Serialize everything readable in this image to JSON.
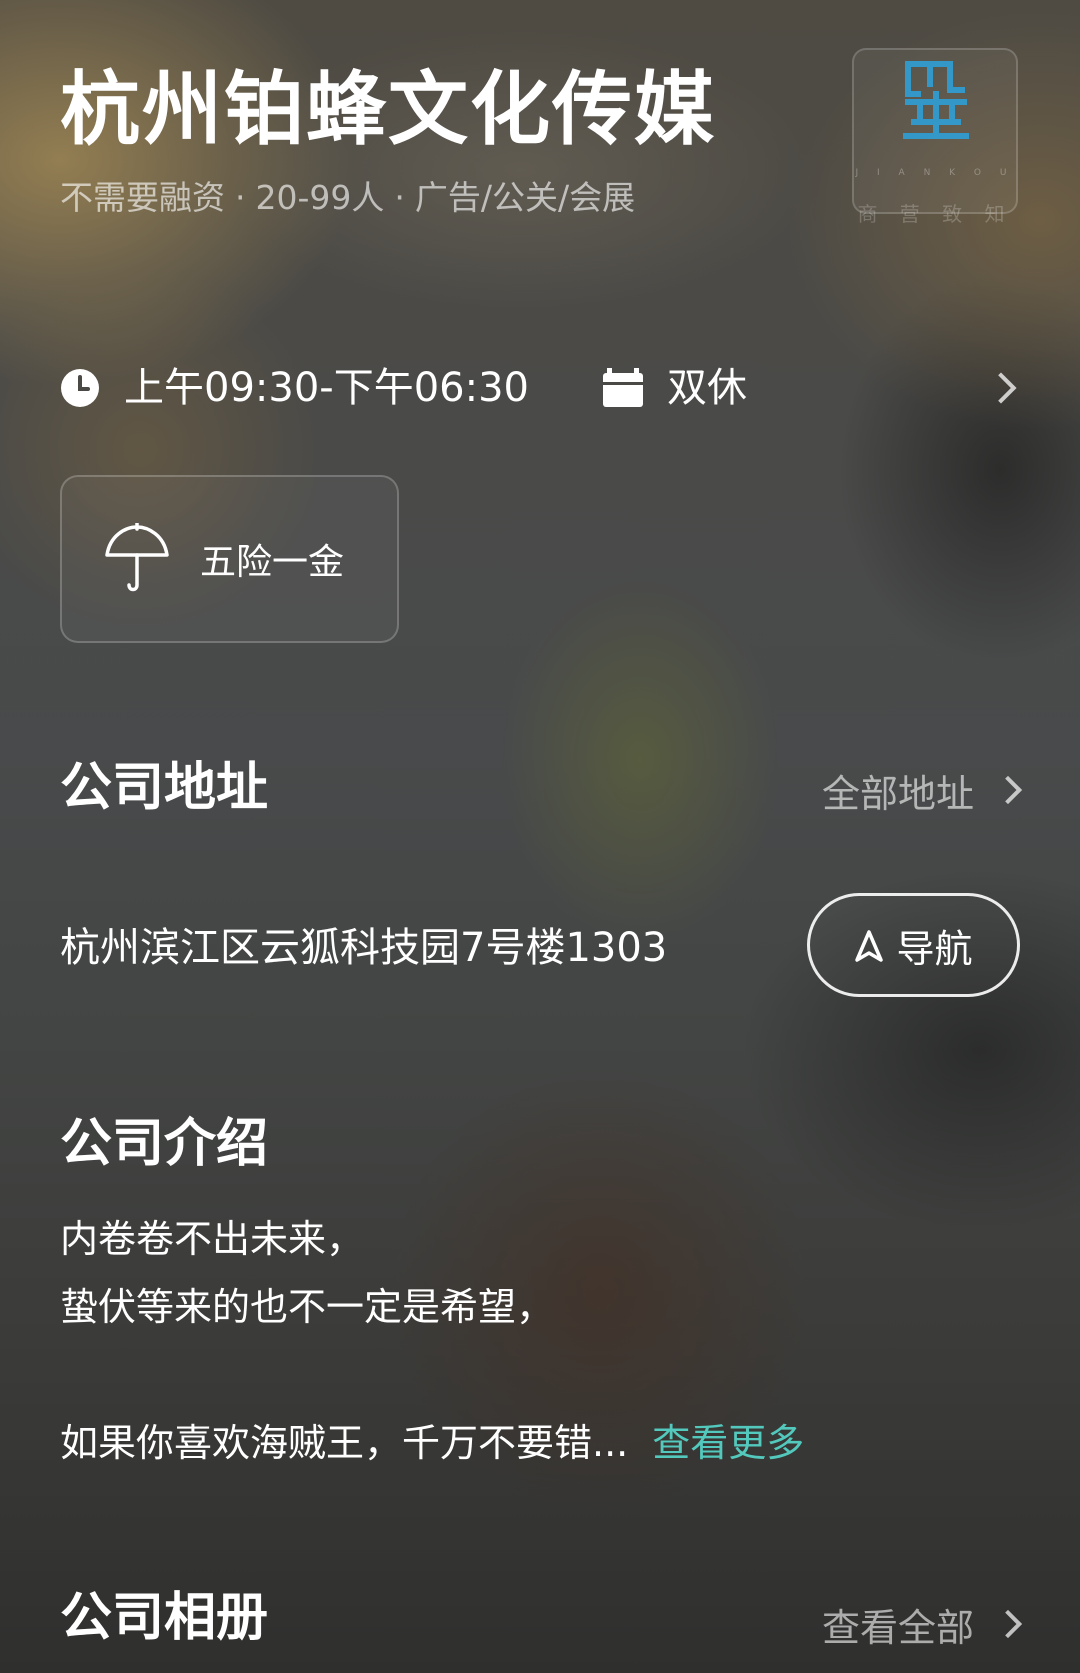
{
  "company": {
    "name": "杭州铂蜂文化传媒",
    "financing": "不需要融资",
    "size": "20-99人",
    "industry": "广告/公关/会展",
    "separator": "·",
    "logo_text": "商 营 致 知",
    "logo_tiny": "J I A N K O U"
  },
  "work": {
    "hours": "上午09:30-下午06:30",
    "rest": "双休"
  },
  "benefits": [
    {
      "label": "五险一金",
      "icon": "umbrella-icon"
    }
  ],
  "address_section": {
    "title": "公司地址",
    "all_link": "全部地址",
    "address": "杭州滨江区云狐科技园7号楼1303",
    "nav_label": "导航"
  },
  "intro_section": {
    "title": "公司介绍",
    "lines": [
      "内卷卷不出未来，",
      "蛰伏等来的也不一定是希望，",
      "",
      "如果你喜欢海贼王，千万不要错..."
    ],
    "more_link": "查看更多"
  },
  "album_section": {
    "title": "公司相册",
    "all_link": "查看全部"
  },
  "colors": {
    "accent_link": "#53c9bd",
    "logo_blue": "#2f9fd6"
  }
}
